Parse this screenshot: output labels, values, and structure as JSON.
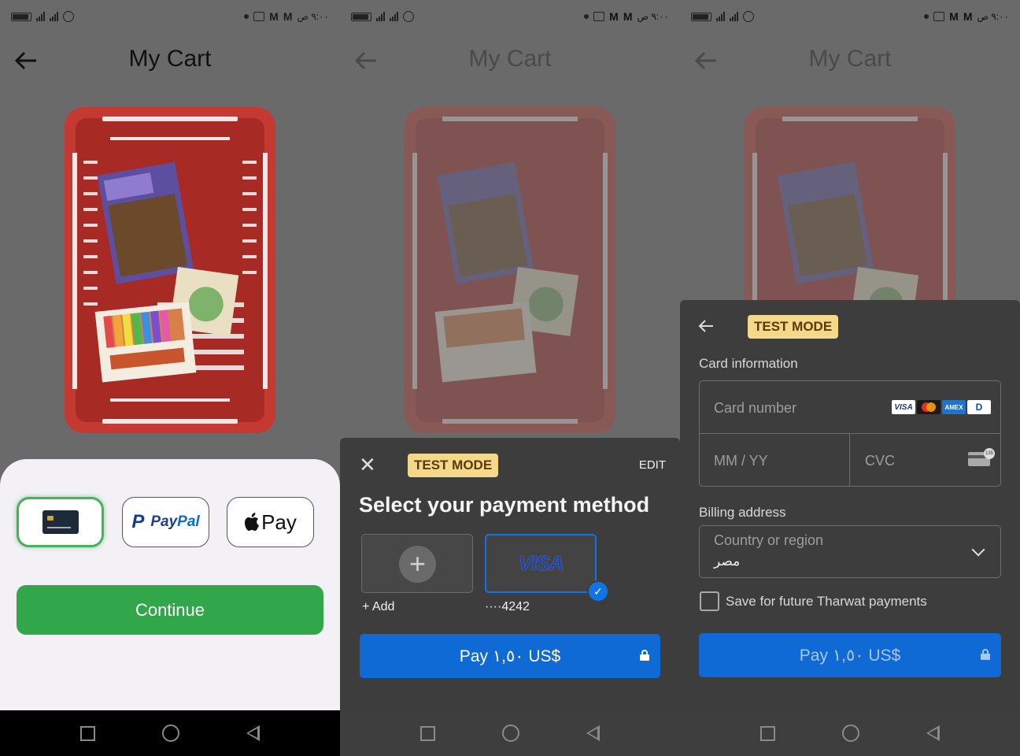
{
  "status_bar": {
    "time": "٩:٠٠ ص"
  },
  "screen1": {
    "title": "My Cart",
    "payment_options": {
      "paypal_left": "Pay",
      "paypal_right": "Pal",
      "apple": "Pay"
    },
    "continue_label": "Continue"
  },
  "screen2": {
    "title": "My Cart",
    "badge": "TEST MODE",
    "edit_label": "EDIT",
    "heading": "Select your payment method",
    "add_label": "+ Add",
    "card_brand": "VISA",
    "card_last4": "····4242",
    "pay_label": "Pay ١,٥٠ US$"
  },
  "screen3": {
    "title": "My Cart",
    "badge": "TEST MODE",
    "card_info_label": "Card information",
    "card_number_placeholder": "Card number",
    "expiry_placeholder": "MM / YY",
    "cvc_placeholder": "CVC",
    "billing_label": "Billing address",
    "country_placeholder": "Country or region",
    "country_value": "مصر",
    "save_label": "Save for future Tharwat payments",
    "pay_label": "Pay ١,٥٠ US$",
    "brand_visa": "VISA",
    "brand_amex": "AMEX",
    "brand_dc": "D"
  },
  "colors": {
    "accent_green": "#31a64a",
    "stripe_blue": "#0f6ad6",
    "test_badge": "#f6d88a",
    "sheet_dark": "#3d3d3d"
  }
}
